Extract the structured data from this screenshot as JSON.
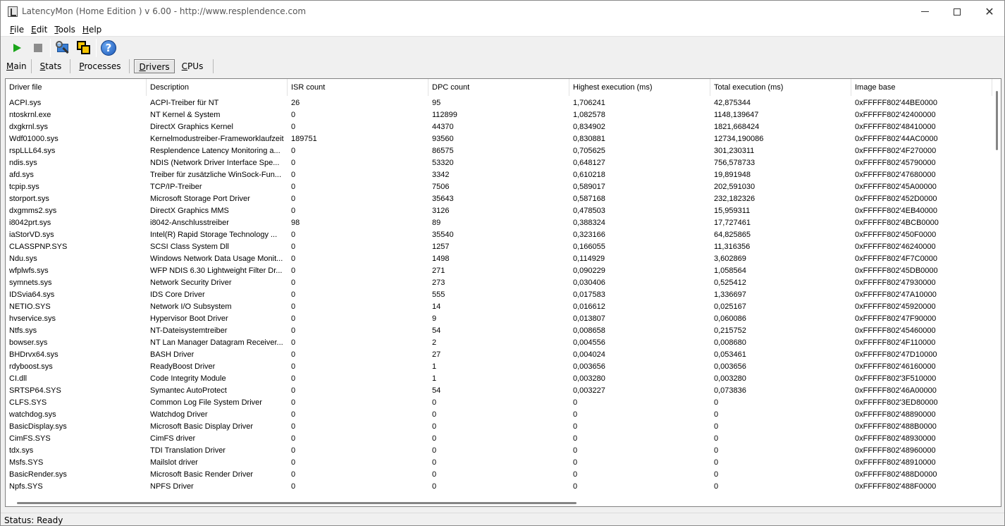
{
  "window": {
    "title": "LatencyMon  (Home Edition )  v 6.00 - http://www.resplendence.com"
  },
  "menu": [
    {
      "ul": "F",
      "rest": "ile"
    },
    {
      "ul": "E",
      "rest": "dit"
    },
    {
      "ul": "T",
      "rest": "ools"
    },
    {
      "ul": "H",
      "rest": "elp"
    }
  ],
  "toolbar": {
    "icons": [
      "play-icon",
      "stop-icon",
      "monitor-magnify-icon",
      "windows-icon",
      "help-icon"
    ],
    "help_glyph": "?"
  },
  "tabs": [
    {
      "pre": "",
      "ul": "M",
      "rest": "ain"
    },
    {
      "pre": "",
      "ul": "S",
      "rest": "tats"
    },
    {
      "pre": "",
      "ul": "P",
      "rest": "rocesses"
    },
    {
      "pre": "",
      "ul": "D",
      "rest": "rivers"
    },
    {
      "pre": "",
      "ul": "C",
      "rest": "PUs"
    }
  ],
  "active_tab": 3,
  "grid": {
    "columns": [
      "Driver file",
      "Description",
      "ISR count",
      "DPC count",
      "Highest execution (ms)",
      "Total execution (ms)",
      "Image base"
    ],
    "rows": [
      [
        "ACPI.sys",
        "ACPI-Treiber für NT",
        "26",
        "95",
        "1,706241",
        "42,875344",
        "0xFFFFF802'44BE0000"
      ],
      [
        "ntoskrnl.exe",
        "NT Kernel & System",
        "0",
        "112899",
        "1,082578",
        "1148,139647",
        "0xFFFFF802'42400000"
      ],
      [
        "dxgkrnl.sys",
        "DirectX Graphics Kernel",
        "0",
        "44370",
        "0,834902",
        "1821,668424",
        "0xFFFFF802'48410000"
      ],
      [
        "Wdf01000.sys",
        "Kernelmodustreiber-Frameworklaufzeit",
        "189751",
        "93560",
        "0,830881",
        "12734,190086",
        "0xFFFFF802'44AC0000"
      ],
      [
        "rspLLL64.sys",
        "Resplendence Latency Monitoring a...",
        "0",
        "86575",
        "0,705625",
        "301,230311",
        "0xFFFFF802'4F270000"
      ],
      [
        "ndis.sys",
        "NDIS (Network Driver Interface Spe...",
        "0",
        "53320",
        "0,648127",
        "756,578733",
        "0xFFFFF802'45790000"
      ],
      [
        "afd.sys",
        "Treiber für zusätzliche WinSock-Fun...",
        "0",
        "3342",
        "0,610218",
        "19,891948",
        "0xFFFFF802'47680000"
      ],
      [
        "tcpip.sys",
        "TCP/IP-Treiber",
        "0",
        "7506",
        "0,589017",
        "202,591030",
        "0xFFFFF802'45A00000"
      ],
      [
        "storport.sys",
        "Microsoft Storage Port Driver",
        "0",
        "35643",
        "0,587168",
        "232,182326",
        "0xFFFFF802'452D0000"
      ],
      [
        "dxgmms2.sys",
        "DirectX Graphics MMS",
        "0",
        "3126",
        "0,478503",
        "15,959311",
        "0xFFFFF802'4EB40000"
      ],
      [
        "i8042prt.sys",
        "i8042-Anschlusstreiber",
        "98",
        "89",
        "0,388324",
        "17,727461",
        "0xFFFFF802'4BCB0000"
      ],
      [
        "iaStorVD.sys",
        "Intel(R) Rapid Storage Technology ...",
        "0",
        "35540",
        "0,323166",
        "64,825865",
        "0xFFFFF802'450F0000"
      ],
      [
        "CLASSPNP.SYS",
        "SCSI Class System Dll",
        "0",
        "1257",
        "0,166055",
        "11,316356",
        "0xFFFFF802'46240000"
      ],
      [
        "Ndu.sys",
        "Windows Network Data Usage Monit...",
        "0",
        "1498",
        "0,114929",
        "3,602869",
        "0xFFFFF802'4F7C0000"
      ],
      [
        "wfplwfs.sys",
        "WFP NDIS 6.30 Lightweight Filter Dr...",
        "0",
        "271",
        "0,090229",
        "1,058564",
        "0xFFFFF802'45DB0000"
      ],
      [
        "symnets.sys",
        "Network Security Driver",
        "0",
        "273",
        "0,030406",
        "0,525412",
        "0xFFFFF802'47930000"
      ],
      [
        "IDSvia64.sys",
        "IDS Core Driver",
        "0",
        "555",
        "0,017583",
        "1,336697",
        "0xFFFFF802'47A10000"
      ],
      [
        "NETIO.SYS",
        "Network I/O Subsystem",
        "0",
        "14",
        "0,016612",
        "0,025167",
        "0xFFFFF802'45920000"
      ],
      [
        "hvservice.sys",
        "Hypervisor Boot Driver",
        "0",
        "9",
        "0,013807",
        "0,060086",
        "0xFFFFF802'47F90000"
      ],
      [
        "Ntfs.sys",
        "NT-Dateisystemtreiber",
        "0",
        "54",
        "0,008658",
        "0,215752",
        "0xFFFFF802'45460000"
      ],
      [
        "bowser.sys",
        "NT Lan Manager Datagram Receiver...",
        "0",
        "2",
        "0,004556",
        "0,008680",
        "0xFFFFF802'4F110000"
      ],
      [
        "BHDrvx64.sys",
        "BASH Driver",
        "0",
        "27",
        "0,004024",
        "0,053461",
        "0xFFFFF802'47D10000"
      ],
      [
        "rdyboost.sys",
        "ReadyBoost Driver",
        "0",
        "1",
        "0,003656",
        "0,003656",
        "0xFFFFF802'46160000"
      ],
      [
        "CI.dll",
        "Code Integrity Module",
        "0",
        "1",
        "0,003280",
        "0,003280",
        "0xFFFFF802'3F510000"
      ],
      [
        "SRTSP64.SYS",
        "Symantec AutoProtect",
        "0",
        "54",
        "0,003227",
        "0,073836",
        "0xFFFFF802'46A00000"
      ],
      [
        "CLFS.SYS",
        "Common Log File System Driver",
        "0",
        "0",
        "0",
        "0",
        "0xFFFFF802'3ED80000"
      ],
      [
        "watchdog.sys",
        "Watchdog Driver",
        "0",
        "0",
        "0",
        "0",
        "0xFFFFF802'48890000"
      ],
      [
        "BasicDisplay.sys",
        "Microsoft Basic Display Driver",
        "0",
        "0",
        "0",
        "0",
        "0xFFFFF802'488B0000"
      ],
      [
        "CimFS.SYS",
        "CimFS driver",
        "0",
        "0",
        "0",
        "0",
        "0xFFFFF802'48930000"
      ],
      [
        "tdx.sys",
        "TDI Translation Driver",
        "0",
        "0",
        "0",
        "0",
        "0xFFFFF802'48960000"
      ],
      [
        "Msfs.SYS",
        "Mailslot driver",
        "0",
        "0",
        "0",
        "0",
        "0xFFFFF802'48910000"
      ],
      [
        "BasicRender.sys",
        "Microsoft Basic Render Driver",
        "0",
        "0",
        "0",
        "0",
        "0xFFFFF802'488D0000"
      ],
      [
        "Npfs.SYS",
        "NPFS Driver",
        "0",
        "0",
        "0",
        "0",
        "0xFFFFF802'488F0000"
      ]
    ]
  },
  "status": "Status: Ready"
}
